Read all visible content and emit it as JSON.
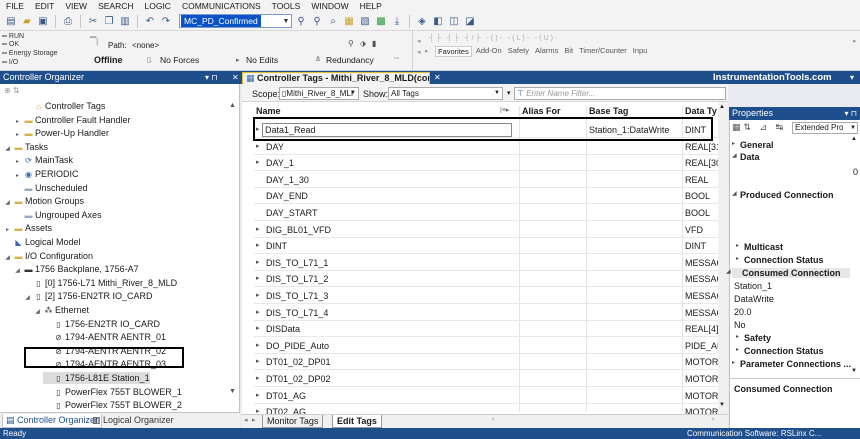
{
  "menu": [
    "FILE",
    "EDIT",
    "VIEW",
    "SEARCH",
    "LOGIC",
    "COMMUNICATIONS",
    "TOOLS",
    "WINDOW",
    "HELP"
  ],
  "toolbar": {
    "routine_combo": "MC_PD_Confirmed"
  },
  "status": {
    "run": "RUN",
    "ok": "OK",
    "energy": "Energy Storage",
    "io": "I/O",
    "path_label": "Path:",
    "path_value": "<none>",
    "mode": "Offline",
    "forces": "No Forces",
    "edits": "No Edits",
    "redundancy": "Redundancy"
  },
  "instruction_tabs": [
    "Favorites",
    "Add-On",
    "Safety",
    "Alarms",
    "Bit",
    "Timer/Counter",
    "Inpu"
  ],
  "organizer": {
    "title": "Controller Organizer",
    "items": [
      {
        "label": "Controller Tags",
        "indent": 2
      },
      {
        "label": "Controller Fault Handler",
        "indent": 1
      },
      {
        "label": "Power-Up Handler",
        "indent": 1
      },
      {
        "label": "Tasks",
        "indent": 0
      },
      {
        "label": "MainTask",
        "indent": 1
      },
      {
        "label": "PERIODIC",
        "indent": 1
      },
      {
        "label": "Unscheduled",
        "indent": 1
      },
      {
        "label": "Motion Groups",
        "indent": 0
      },
      {
        "label": "Ungrouped Axes",
        "indent": 1
      },
      {
        "label": "Assets",
        "indent": 0
      },
      {
        "label": "Logical Model",
        "indent": 0
      },
      {
        "label": "I/O Configuration",
        "indent": 0
      },
      {
        "label": "1756 Backplane, 1756-A7",
        "indent": 1
      },
      {
        "label": "[0] 1756-L71 Mithi_River_8_MLD",
        "indent": 2
      },
      {
        "label": "[2] 1756-EN2TR IO_CARD",
        "indent": 2
      },
      {
        "label": "Ethernet",
        "indent": 3
      },
      {
        "label": "1756-EN2TR IO_CARD",
        "indent": 4
      },
      {
        "label": "1794-AENTR AENTR_01",
        "indent": 4
      },
      {
        "label": "1794-AENTR AENTR_02",
        "indent": 4
      },
      {
        "label": "1794-AENTR AENTR_03",
        "indent": 4
      },
      {
        "label": "1756-L81E Station_1",
        "indent": 4
      },
      {
        "label": "PowerFlex 755T BLOWER_1",
        "indent": 4
      },
      {
        "label": "PowerFlex 755T BLOWER_2",
        "indent": 4
      },
      {
        "label": "PowerFlex 755T BLOWER_3",
        "indent": 4
      }
    ],
    "tabs": [
      "Controller Organizer",
      "Logical Organizer"
    ]
  },
  "tags_window": {
    "title": "Controller Tags - Mithi_River_8_MLD(controller)",
    "brand": "InstrumentationTools.com",
    "scope_label": "Scope:",
    "scope_value": "Mithi_River_8_MLI",
    "show_label": "Show:",
    "show_value": "All Tags",
    "filter_placeholder": "Enter Name Filter...",
    "columns": {
      "name": "Name",
      "alias": "Alias For",
      "base": "Base Tag",
      "type": "Data Ty"
    },
    "rows": [
      {
        "name": "Data1_Read",
        "base": "Station_1:DataWrite",
        "type": "DINT",
        "exp": true
      },
      {
        "name": "DAY",
        "base": "",
        "type": "REAL[31]",
        "exp": true
      },
      {
        "name": "DAY_1",
        "base": "",
        "type": "REAL[30]",
        "exp": true
      },
      {
        "name": "DAY_1_30",
        "base": "",
        "type": "REAL",
        "exp": false
      },
      {
        "name": "DAY_END",
        "base": "",
        "type": "BOOL",
        "exp": false
      },
      {
        "name": "DAY_START",
        "base": "",
        "type": "BOOL",
        "exp": false
      },
      {
        "name": "DIG_BL01_VFD",
        "base": "",
        "type": "VFD",
        "exp": true
      },
      {
        "name": "DINT",
        "base": "",
        "type": "DINT",
        "exp": true
      },
      {
        "name": "DIS_TO_L71_1",
        "base": "",
        "type": "MESSAG",
        "exp": true
      },
      {
        "name": "DIS_TO_L71_2",
        "base": "",
        "type": "MESSAG",
        "exp": true
      },
      {
        "name": "DIS_TO_L71_3",
        "base": "",
        "type": "MESSAG",
        "exp": true
      },
      {
        "name": "DIS_TO_L71_4",
        "base": "",
        "type": "MESSAG",
        "exp": true
      },
      {
        "name": "DISData",
        "base": "",
        "type": "REAL[4]",
        "exp": true
      },
      {
        "name": "DO_PIDE_Auto",
        "base": "",
        "type": "PIDE_AU",
        "exp": true
      },
      {
        "name": "DT01_02_DP01",
        "base": "",
        "type": "MOTOR",
        "exp": true
      },
      {
        "name": "DT01_02_DP02",
        "base": "",
        "type": "MOTOR",
        "exp": true
      },
      {
        "name": "DT01_AG",
        "base": "",
        "type": "MOTOR",
        "exp": true
      },
      {
        "name": "DT02_AG",
        "base": "",
        "type": "MOTOR",
        "exp": true
      }
    ],
    "tabs": [
      "Monitor Tags",
      "Edit Tags"
    ]
  },
  "properties": {
    "title": "Properties",
    "view_select": "Extended Pro",
    "items": [
      {
        "text": "General",
        "bold": true
      },
      {
        "text": "Data",
        "bold": true
      },
      {
        "text": "0",
        "bold": false
      },
      {
        "text": "Produced Connection",
        "bold": true
      },
      {
        "text": "Multicast",
        "bold": true
      },
      {
        "text": "Connection Status",
        "bold": true
      },
      {
        "text": "Consumed Connection",
        "bold": true
      },
      {
        "text": "Station_1",
        "bold": false
      },
      {
        "text": "DataWrite",
        "bold": false
      },
      {
        "text": "20.0",
        "bold": false
      },
      {
        "text": "No",
        "bold": false
      },
      {
        "text": "Safety",
        "bold": true
      },
      {
        "text": "Connection Status",
        "bold": true
      },
      {
        "text": "Parameter Connections ...",
        "bold": true
      }
    ],
    "footer": "Consumed Connection"
  },
  "statusbar": {
    "left": "Ready",
    "right": "Communication Software: RSLinx C..."
  },
  "colors": {
    "accent": "#1f4e8c",
    "selection": "#0a52c8"
  }
}
